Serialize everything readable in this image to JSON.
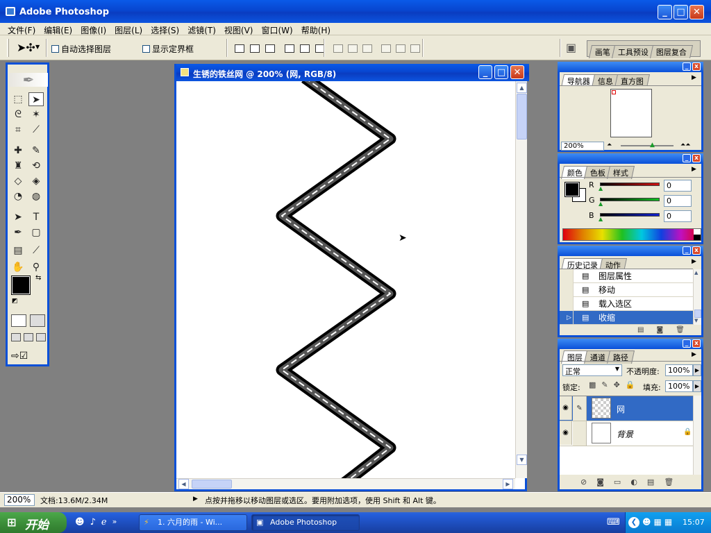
{
  "app": {
    "title": "Adobe Photoshop"
  },
  "menu": [
    "文件(F)",
    "编辑(E)",
    "图像(I)",
    "图层(L)",
    "选择(S)",
    "滤镜(T)",
    "视图(V)",
    "窗口(W)",
    "帮助(H)"
  ],
  "options": {
    "auto_select_label": "自动选择图层",
    "show_bounds_label": "显示定界框",
    "palette_tabs": [
      "画笔",
      "工具预设",
      "图层复合"
    ]
  },
  "document": {
    "title": "生锈的铁丝网 @ 200% (网, RGB/8)"
  },
  "navigator": {
    "tabs": [
      "导航器",
      "信息",
      "直方图"
    ],
    "zoom": "200%"
  },
  "color": {
    "tabs": [
      "颜色",
      "色板",
      "样式"
    ],
    "channels": [
      {
        "label": "R",
        "value": "0",
        "color": "#d01010"
      },
      {
        "label": "G",
        "value": "0",
        "color": "#10c020"
      },
      {
        "label": "B",
        "value": "0",
        "color": "#1020d0"
      }
    ]
  },
  "history": {
    "tabs": [
      "历史记录",
      "动作"
    ],
    "items": [
      {
        "label": "图层属性",
        "selected": false
      },
      {
        "label": "移动",
        "selected": false
      },
      {
        "label": "载入选区",
        "selected": false
      },
      {
        "label": "收缩",
        "selected": true
      }
    ]
  },
  "layers": {
    "tabs": [
      "图层",
      "通道",
      "路径"
    ],
    "blend_mode": "正常",
    "opacity_label": "不透明度:",
    "opacity": "100%",
    "lock_label": "锁定:",
    "fill_label": "填充:",
    "fill": "100%",
    "items": [
      {
        "name": "网",
        "selected": true
      },
      {
        "name": "背景",
        "selected": false
      }
    ]
  },
  "status": {
    "zoom": "200%",
    "doc_info": "文档:13.6M/2.34M",
    "hint": "点按并拖移以移动图层或选区。要用附加选项，使用 Shift 和 Alt 键。"
  },
  "taskbar": {
    "start_label": "开始",
    "tasks": [
      "1. 六月的雨 - Wi...",
      "Adobe Photoshop"
    ],
    "clock": "15:07"
  }
}
